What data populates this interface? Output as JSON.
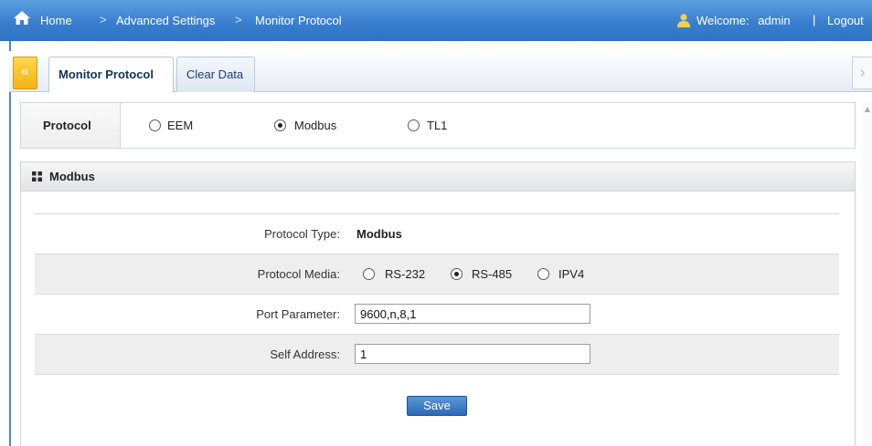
{
  "breadcrumb": {
    "items": [
      "Home",
      "Advanced Settings",
      "Monitor Protocol"
    ],
    "separator": ">"
  },
  "user": {
    "welcome_label": "Welcome:",
    "username": "admin",
    "separator": "|",
    "logout_label": "Logout"
  },
  "tabs": [
    {
      "label": "Monitor Protocol",
      "active": true
    },
    {
      "label": "Clear Data",
      "active": false
    }
  ],
  "icons": {
    "collapse": "double-chevron-left-icon",
    "scroll_right": "chevron-right-icon",
    "home": "home-icon",
    "user": "user-icon",
    "panel": "grid-icon"
  },
  "protocol": {
    "label": "Protocol",
    "options": [
      "EEM",
      "Modbus",
      "TL1"
    ],
    "selected": "Modbus"
  },
  "panel": {
    "title": "Modbus",
    "rows": {
      "protocol_type": {
        "label": "Protocol Type:",
        "value": "Modbus"
      },
      "protocol_media": {
        "label": "Protocol Media:",
        "options": [
          "RS-232",
          "RS-485",
          "IPV4"
        ],
        "selected": "RS-485"
      },
      "port_parameter": {
        "label": "Port Parameter:",
        "value": "9600,n,8,1"
      },
      "self_address": {
        "label": "Self Address:",
        "value": "1"
      }
    },
    "save_label": "Save"
  },
  "colors": {
    "topbar": "#3a7fcf",
    "accent_yellow": "#f3b21a",
    "save_button": "#2c6ab8"
  }
}
